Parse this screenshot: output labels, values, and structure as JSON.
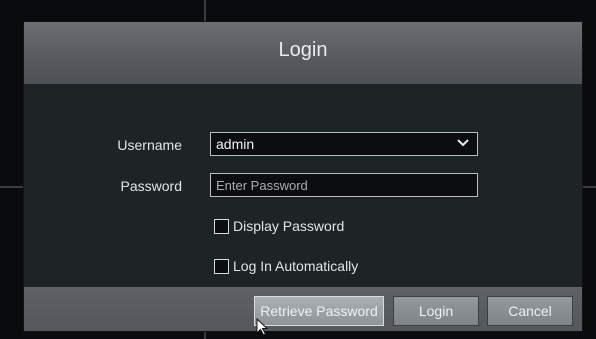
{
  "dialog": {
    "title": "Login"
  },
  "form": {
    "username_label": "Username",
    "username_value": "admin",
    "password_label": "Password",
    "password_placeholder": "Enter Password",
    "display_password_label": "Display Password",
    "display_password_checked": false,
    "auto_login_label": "Log In Automatically",
    "auto_login_checked": false
  },
  "buttons": {
    "retrieve_password": "Retrieve Password",
    "login": "Login",
    "cancel": "Cancel"
  },
  "icons": {
    "dropdown": "chevron-down-icon",
    "cursor": "mouse-pointer-icon"
  },
  "colors": {
    "dialog_bg": "#1e2426",
    "title_bar": "#5d6165",
    "button": "#8a8f93"
  }
}
